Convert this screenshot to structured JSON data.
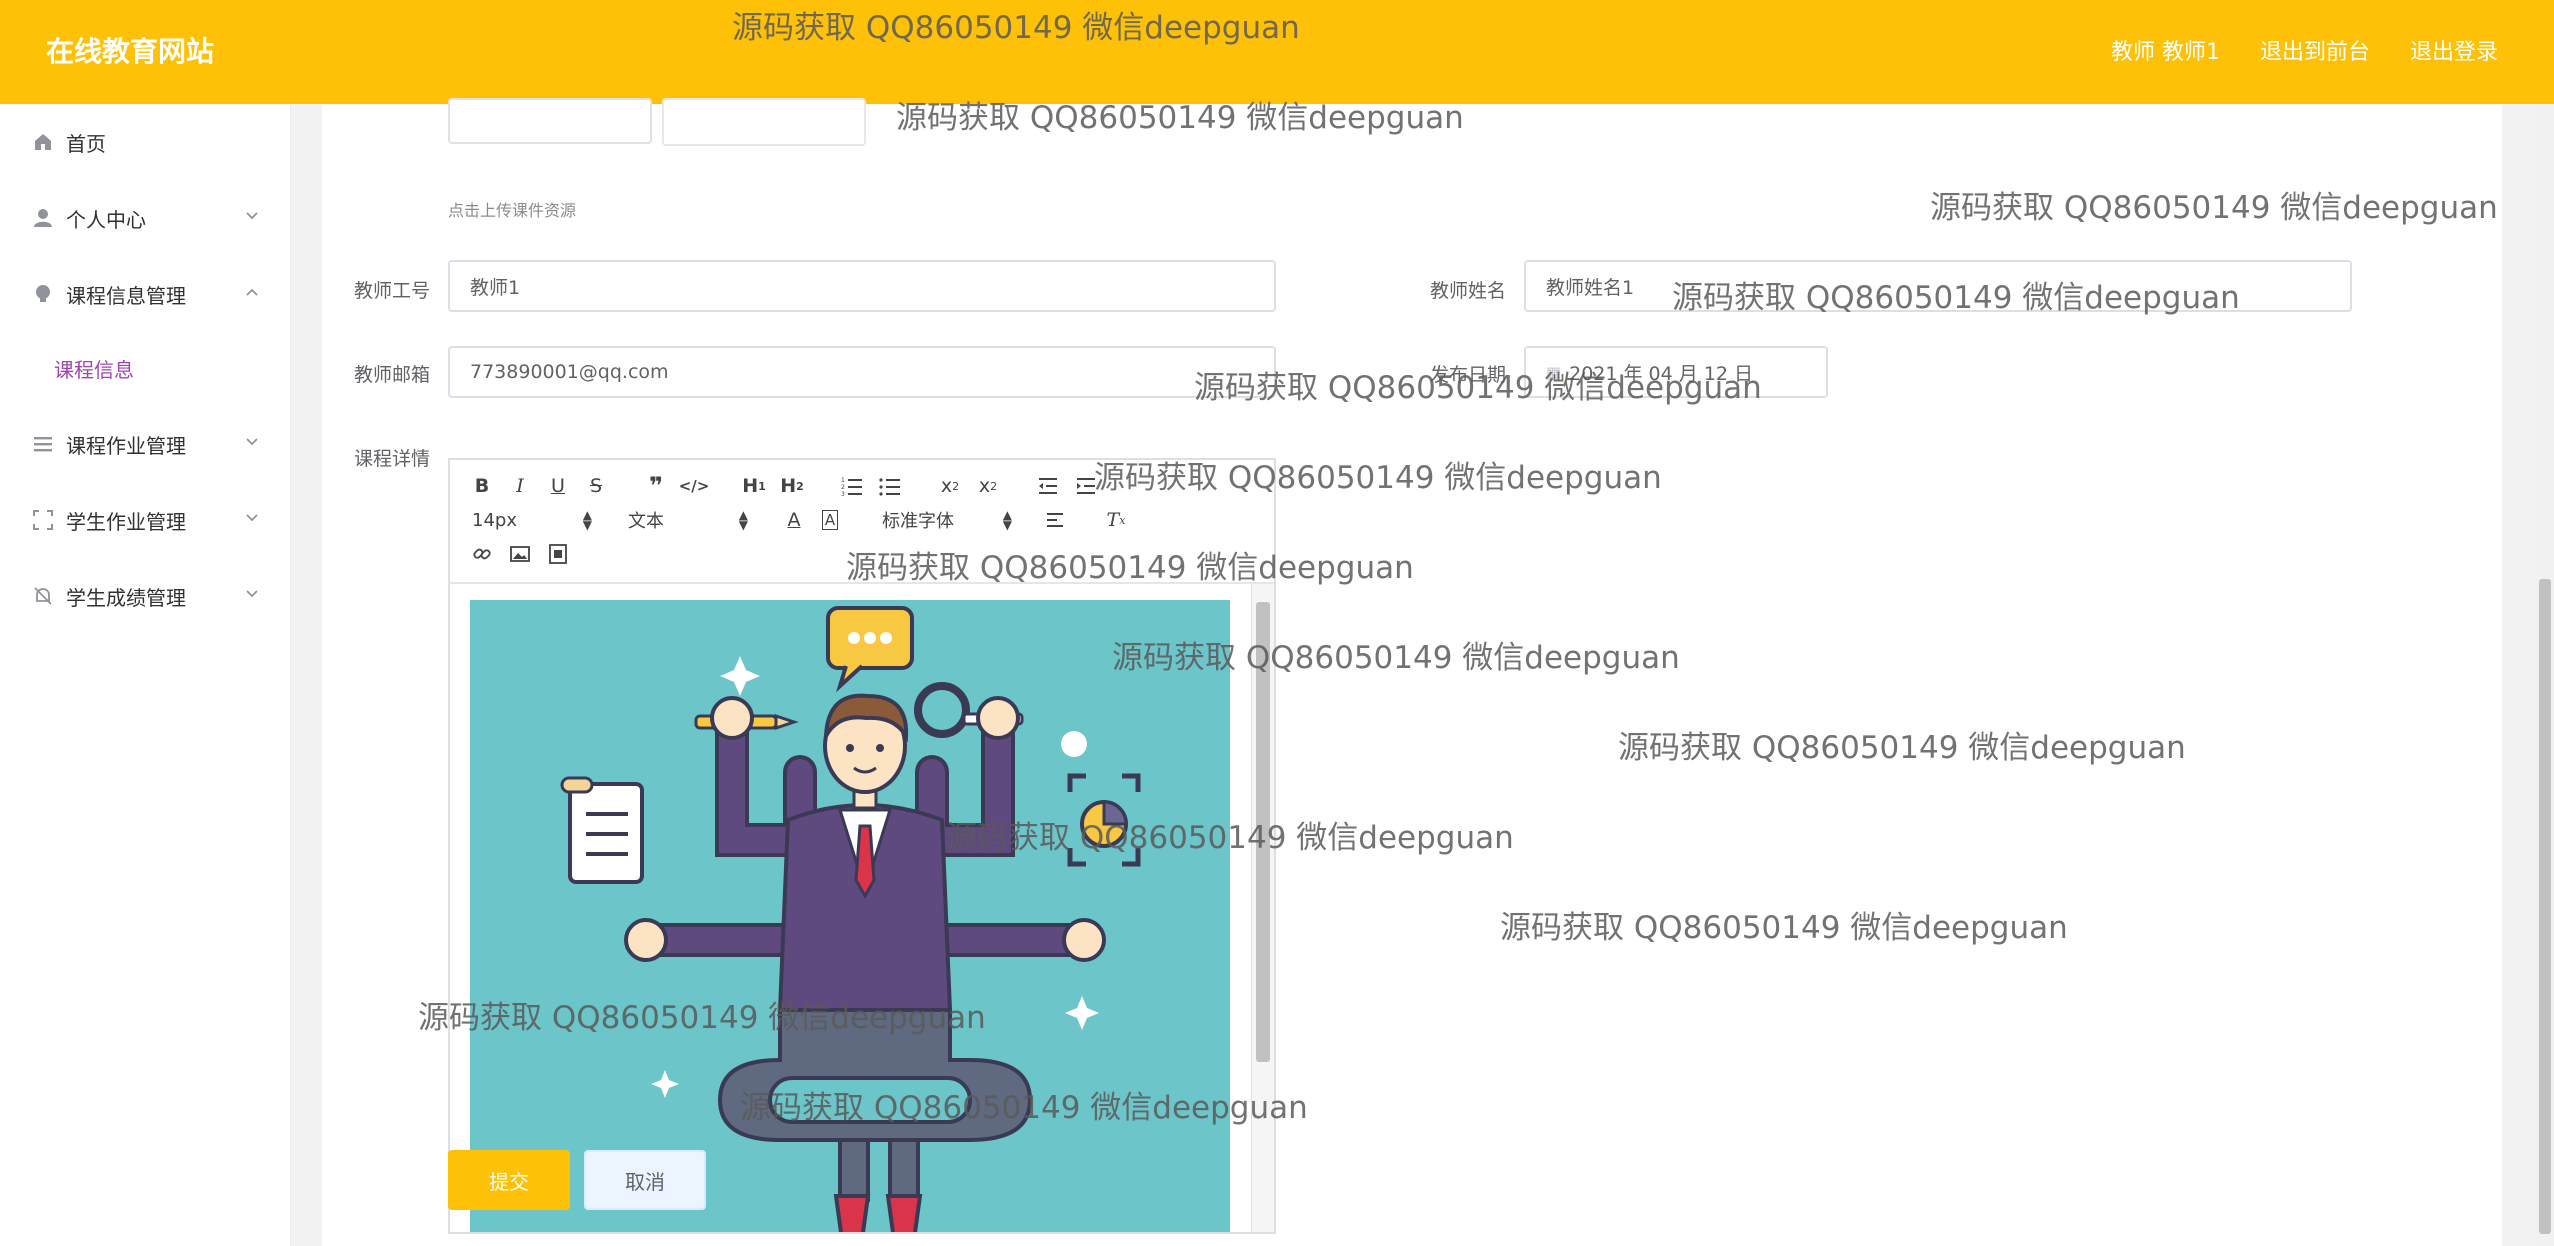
{
  "header": {
    "title": "在线教育网站",
    "links": [
      "教师 教师1",
      "退出到前台",
      "退出登录"
    ]
  },
  "sidebar": {
    "items": [
      {
        "label": "首页",
        "icon": "home-icon"
      },
      {
        "label": "个人中心",
        "icon": "user-icon"
      },
      {
        "label": "课程信息管理",
        "icon": "bulb-icon"
      },
      {
        "label": "课程信息",
        "icon": ""
      },
      {
        "label": "课程作业管理",
        "icon": "list-icon"
      },
      {
        "label": "学生作业管理",
        "icon": "frame-icon"
      },
      {
        "label": "学生成绩管理",
        "icon": "bell-off-icon"
      }
    ]
  },
  "form": {
    "upload_hint": "点击上传课件资源",
    "teacher_id_label": "教师工号",
    "teacher_id_value": "教师1",
    "teacher_name_label": "教师姓名",
    "teacher_name_value": "教师姓名1",
    "email_label": "教师邮箱",
    "email_value": "773890001@qq.com",
    "date_label": "发布日期",
    "date_value": "2021 年 04 月 12 日",
    "details_label": "课程详情",
    "submit_label": "提交",
    "cancel_label": "取消"
  },
  "editor": {
    "font_size": "14px",
    "block_type": "文本",
    "font_family": "标准字体"
  },
  "watermark": "源码获取 QQ86050149 微信deepguan",
  "colors": {
    "brand": "#ffc107",
    "active_menu": "#a044b4",
    "illustration_bg": "#6cc5c9"
  }
}
